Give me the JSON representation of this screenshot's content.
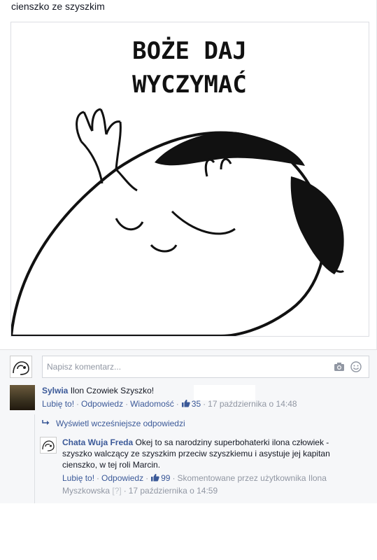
{
  "post": {
    "text": "cienszko ze szyszkim",
    "image": {
      "caption_line1": "BOŻE DAJ",
      "caption_line2": "WYCZYMAĆ"
    }
  },
  "composer": {
    "placeholder": "Napisz komentarz...",
    "camera_icon": "camera-icon",
    "emoji_icon": "smiley-icon"
  },
  "comments": [
    {
      "author": "Sylwia",
      "text": "Ilon Czowiek Szyszko!",
      "actions": {
        "like": "Lubię to!",
        "reply": "Odpowiedz",
        "message": "Wiadomość"
      },
      "likes": "35",
      "timestamp": "17 października o 14:48"
    },
    {
      "author": "Chata Wuja Freda",
      "text": "Okej to sa narodziny superbohaterki ilona człowiek - szyszko walczący ze szyszkim przeciw szyszkiemu i asystuje jej kapitan cienszko, w tej roli Marcin.",
      "actions": {
        "like": "Lubię to!",
        "reply": "Odpowiedz"
      },
      "likes": "99",
      "commented_by": "Skomentowane przez użytkownika Ilona Myszkowska",
      "help_mark": "[?]",
      "timestamp": "17 października o 14:59"
    }
  ],
  "view_previous": "Wyświetl wcześniejsze odpowiedzi",
  "colors": {
    "link": "#3b5998",
    "meta": "#9197a3",
    "bg": "#f6f7f9"
  }
}
